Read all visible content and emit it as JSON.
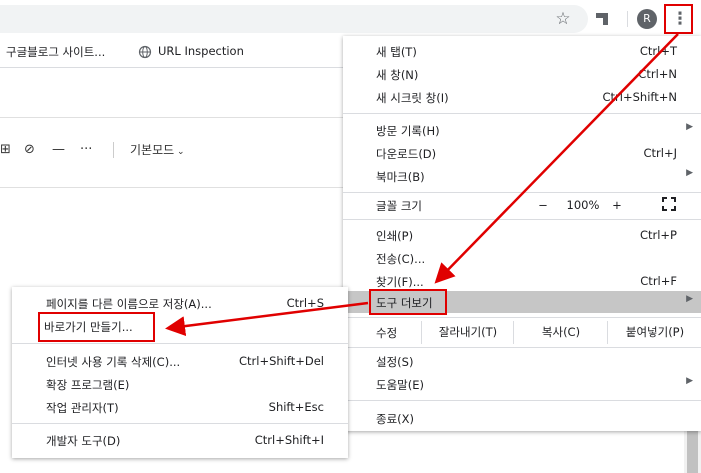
{
  "toolbar": {
    "avatar_letter": "R",
    "icons": [
      "star-icon",
      "extension-icon",
      "kebab-menu-icon"
    ]
  },
  "bookmarks": {
    "item1": "구글블로그 사이트...",
    "item2": "URL Inspection"
  },
  "editor": {
    "mode_label": "기본모드"
  },
  "main_menu": {
    "new_tab": {
      "label": "새 탭(T)",
      "shortcut": "Ctrl+T"
    },
    "new_window": {
      "label": "새 창(N)",
      "shortcut": "Ctrl+N"
    },
    "incognito": {
      "label": "새 시크릿 창(I)",
      "shortcut": "Ctrl+Shift+N"
    },
    "history": {
      "label": "방문 기록(H)"
    },
    "downloads": {
      "label": "다운로드(D)",
      "shortcut": "Ctrl+J"
    },
    "bookmarks": {
      "label": "북마크(B)"
    },
    "zoom": {
      "label": "글꼴 크기",
      "minus": "−",
      "value": "100%",
      "plus": "+"
    },
    "print": {
      "label": "인쇄(P)",
      "shortcut": "Ctrl+P"
    },
    "cast": {
      "label": "전송(C)..."
    },
    "find": {
      "label": "찾기(F)...",
      "shortcut": "Ctrl+F"
    },
    "more_tools": {
      "label": "도구 더보기"
    },
    "edit": {
      "label": "수정",
      "cut": "잘라내기(T)",
      "copy": "복사(C)",
      "paste": "붙여넣기(P)"
    },
    "settings": {
      "label": "설정(S)"
    },
    "help": {
      "label": "도움말(E)"
    },
    "exit": {
      "label": "종료(X)"
    }
  },
  "sub_menu": {
    "save_page": {
      "label": "페이지를 다른 이름으로 저장(A)...",
      "shortcut": "Ctrl+S"
    },
    "create_shortcut": {
      "label": "바로가기 만들기..."
    },
    "clear_data": {
      "label": "인터넷 사용 기록 삭제(C)...",
      "shortcut": "Ctrl+Shift+Del"
    },
    "extensions": {
      "label": "확장 프로그램(E)"
    },
    "task_manager": {
      "label": "작업 관리자(T)",
      "shortcut": "Shift+Esc"
    },
    "dev_tools": {
      "label": "개발자 도구(D)",
      "shortcut": "Ctrl+Shift+I"
    }
  },
  "colors": {
    "annotation": "#e00000",
    "highlight": "#c6c6c6"
  }
}
